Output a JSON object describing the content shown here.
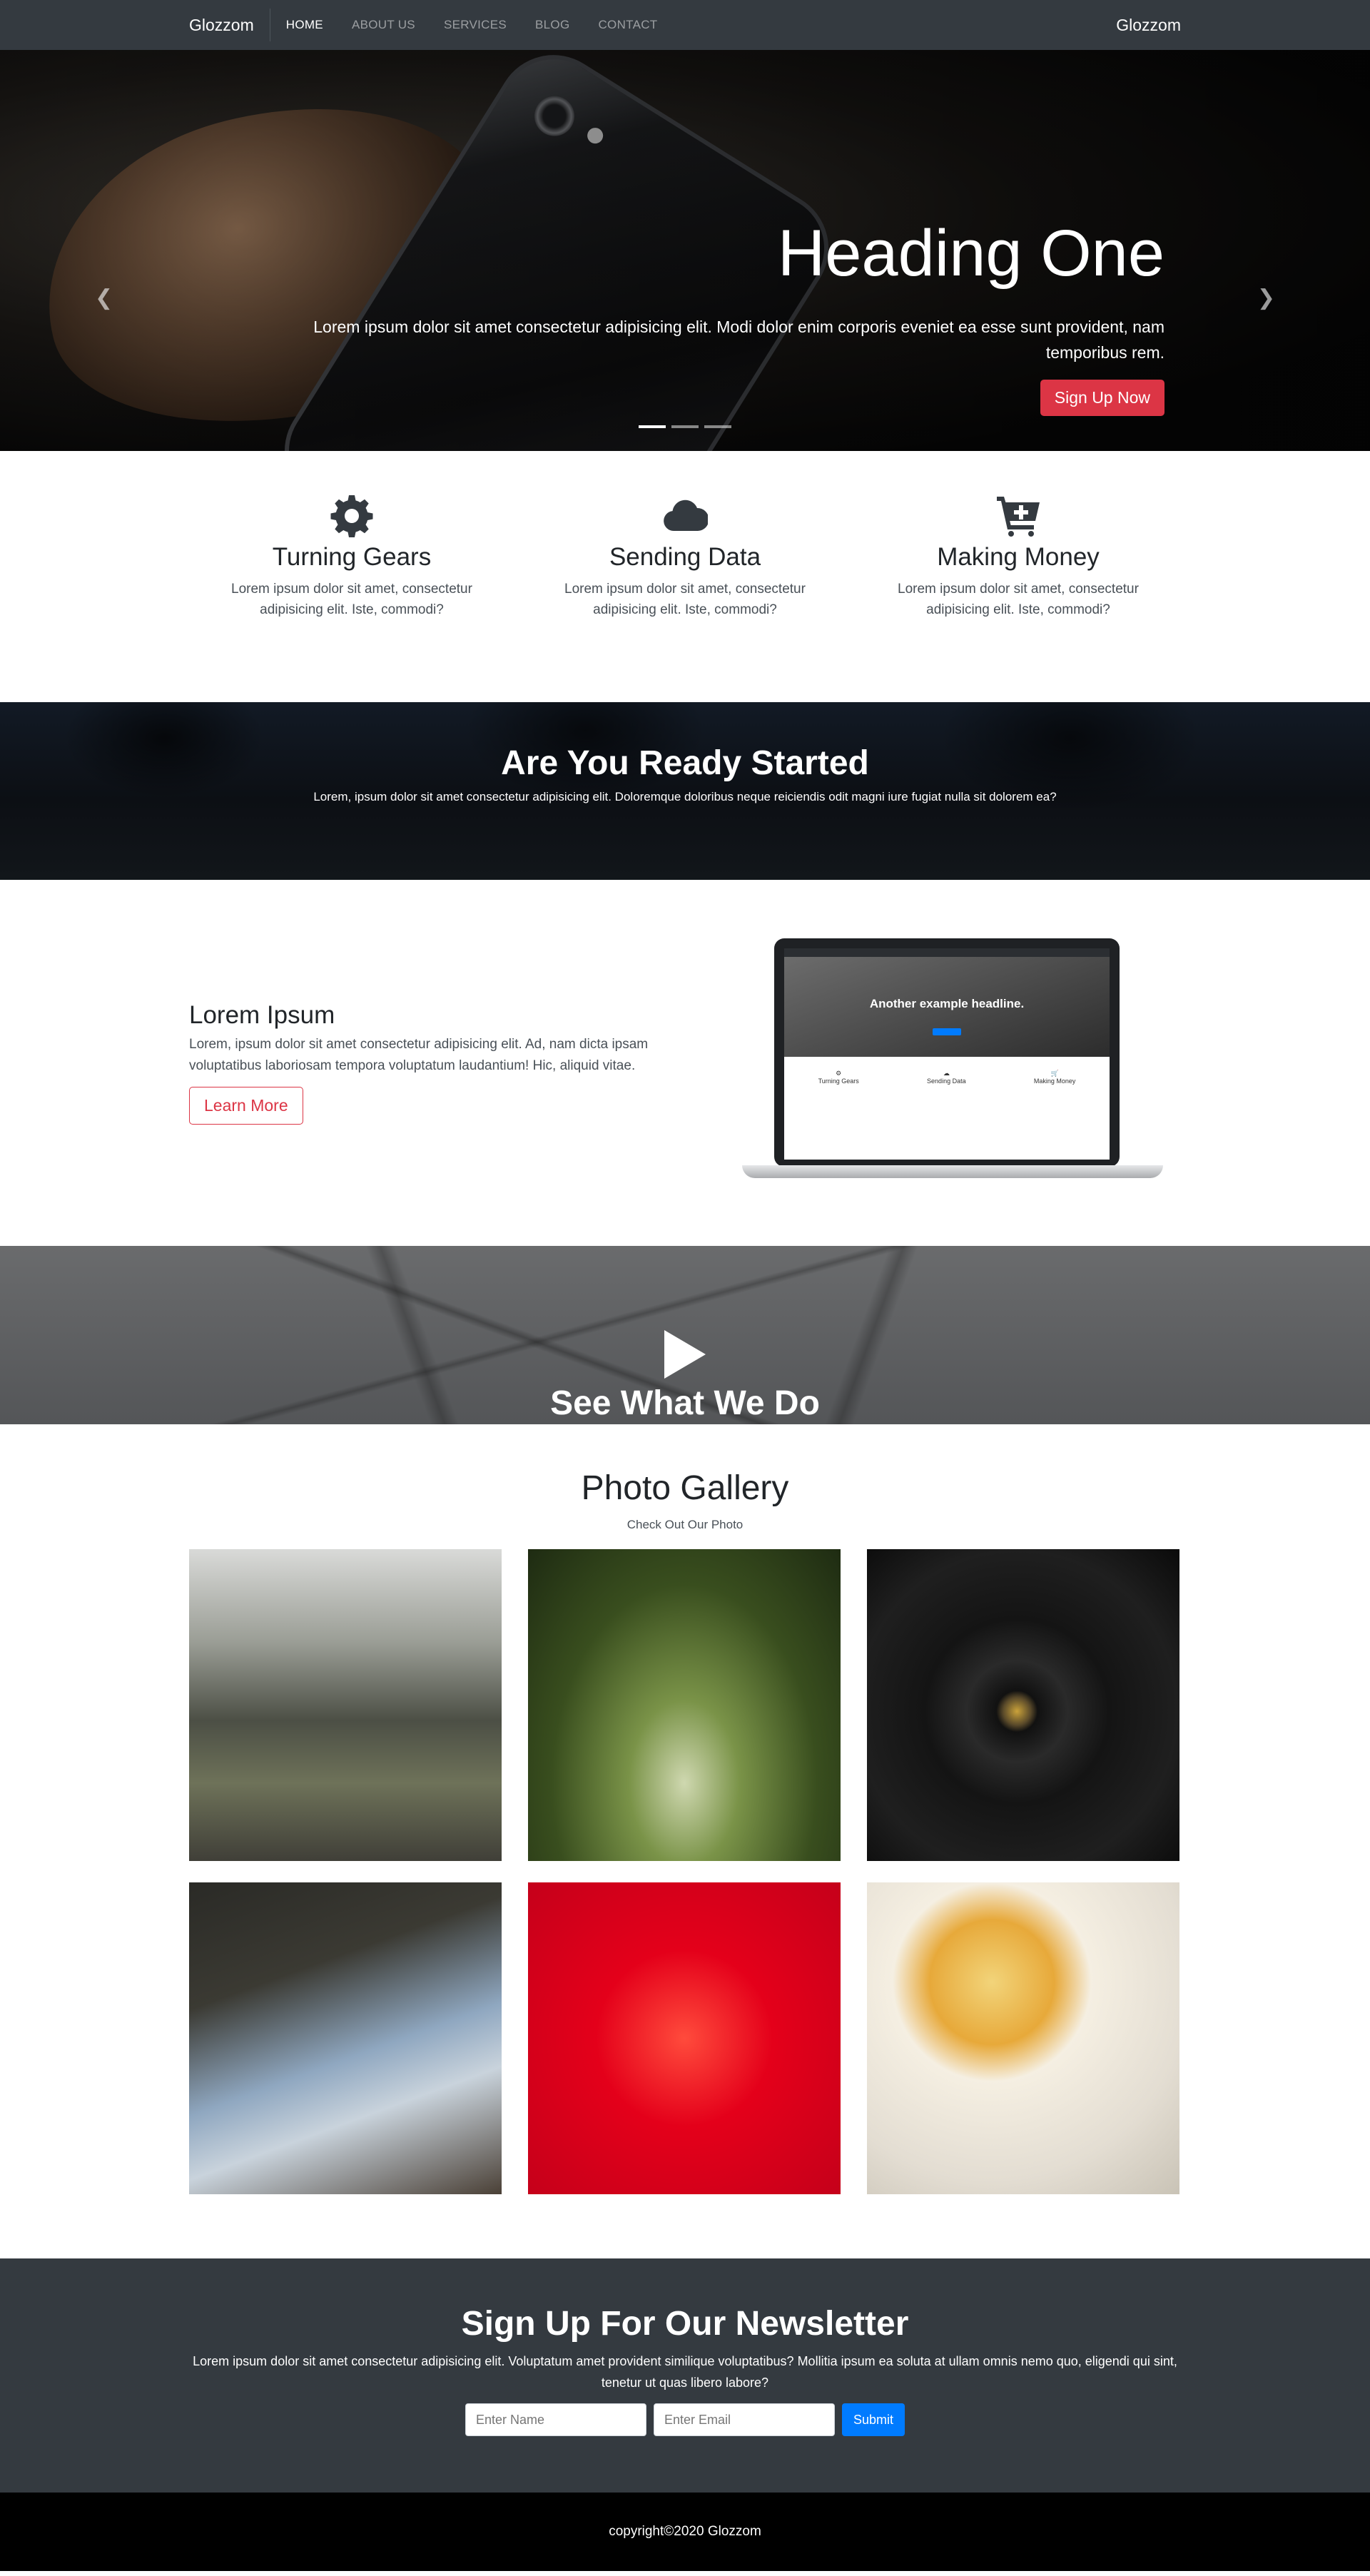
{
  "navbar": {
    "brand": "Glozzom",
    "brand_right": "Glozzom",
    "links": [
      "HOME",
      "ABOUT US",
      "SERVICES",
      "BLOG",
      "CONTACT"
    ]
  },
  "hero": {
    "heading": "Heading One",
    "lead": "Lorem ipsum dolor sit amet consectetur adipisicing elit. Modi dolor enim corporis eveniet ea esse sunt provident, nam temporibus rem.",
    "button": "Sign Up Now",
    "prev_icon": "chevron-left-icon",
    "next_icon": "chevron-right-icon",
    "slides": 3,
    "active_slide": 1
  },
  "features": [
    {
      "icon": "gear-icon",
      "title": "Turning Gears",
      "text": "Lorem ipsum dolor sit amet, consectetur adipisicing elit. Iste, commodi?"
    },
    {
      "icon": "cloud-icon",
      "title": "Sending Data",
      "text": "Lorem ipsum dolor sit amet, consectetur adipisicing elit. Iste, commodi?"
    },
    {
      "icon": "cart-plus-icon",
      "title": "Making Money",
      "text": "Lorem ipsum dolor sit amet, consectetur adipisicing elit. Iste, commodi?"
    }
  ],
  "ready": {
    "title": "Are You Ready Started",
    "text": "Lorem, ipsum dolor sit amet consectetur adipisicing elit. Doloremque doloribus neque reiciendis odit magni iure fugiat nulla sit dolorem ea?"
  },
  "info": {
    "title": "Lorem Ipsum",
    "text": "Lorem, ipsum dolor sit amet consectetur adipisicing elit. Ad, nam dicta ipsam voluptatibus laboriosam tempora voluptatum laudantium! Hic, aliquid vitae.",
    "button": "Learn More",
    "laptop_headline": "Another example headline.",
    "laptop_features": [
      "Turning Gears",
      "Sending Data",
      "Making Money"
    ]
  },
  "video": {
    "title": "See What We Do",
    "icon": "play-icon"
  },
  "gallery": {
    "title": "Photo Gallery",
    "subtitle": "Check Out Our Photo"
  },
  "newsletter": {
    "title": "Sign Up For Our Newsletter",
    "text": "Lorem ipsum dolor sit amet consectetur adipisicing elit. Voluptatum amet provident similique voluptatibus? Mollitia ipsum ea soluta at ullam omnis nemo quo, eligendi qui sint, tenetur ut quas libero labore?",
    "name_placeholder": "Enter Name",
    "email_placeholder": "Enter Email",
    "submit": "Submit"
  },
  "footer": {
    "copyright": "copyright©2020 Glozzom"
  },
  "colors": {
    "dark": "#343a40",
    "danger": "#dc3545",
    "primary": "#007bff"
  }
}
